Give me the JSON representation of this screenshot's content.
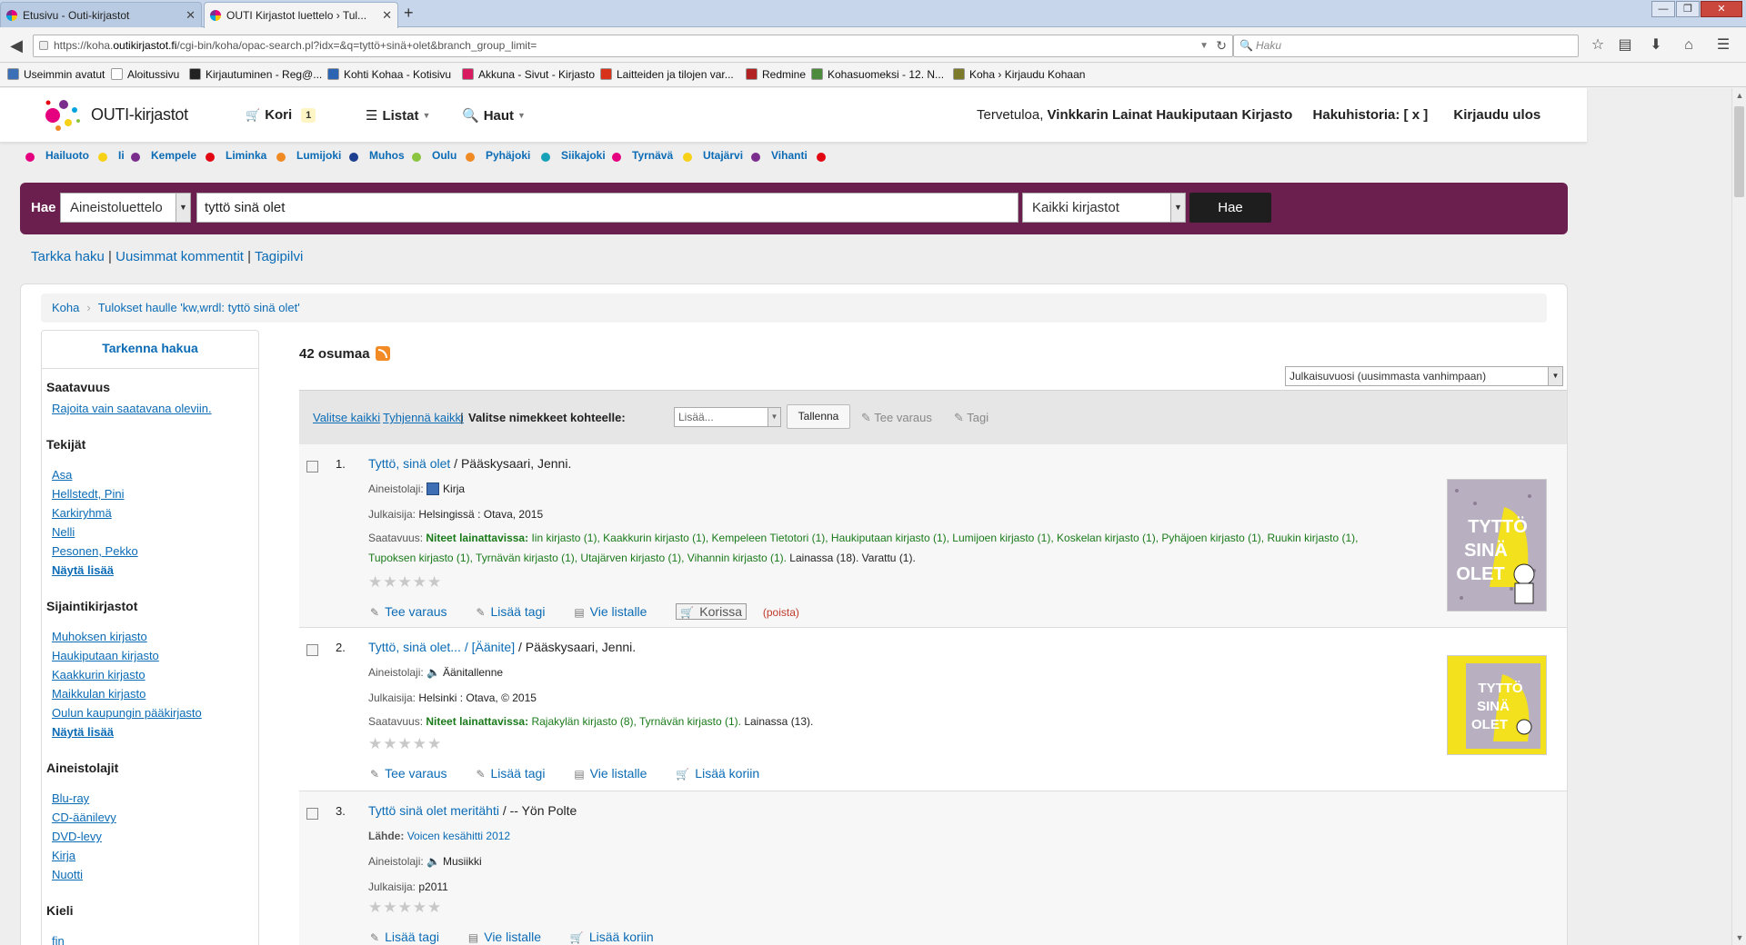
{
  "browser": {
    "tabs": [
      {
        "label": "Etusivu - Outi-kirjastot"
      },
      {
        "label": "OUTI Kirjastot luettelo › Tul..."
      }
    ],
    "new_tab": "+",
    "url_prefix": "https://koha.",
    "url_host": "outikirjastot.fi",
    "url_rest": "/cgi-bin/koha/opac-search.pl?idx=&q=tyttö+sinä+olet&branch_group_limit=",
    "search_placeholder": "Haku",
    "bookmarks": [
      {
        "label": "Useimmin avatut",
        "color": "#3b6fb6"
      },
      {
        "label": "Aloitussivu",
        "color": "#ffffff"
      },
      {
        "label": "Kirjautuminen - Reg@...",
        "color": "#222222"
      },
      {
        "label": "Kohti Kohaa - Kotisivu",
        "color": "#2b64b2"
      },
      {
        "label": "Akkuna - Sivut - Kirjasto",
        "color": "#d81b60"
      },
      {
        "label": "Laitteiden ja tilojen var...",
        "color": "#d8321b"
      },
      {
        "label": "Redmine",
        "color": "#b22222"
      },
      {
        "label": "Kohasuomeksi - 12. N...",
        "color": "#4c8a3c"
      },
      {
        "label": "Koha › Kirjaudu Kohaan",
        "color": "#7a7a2a"
      }
    ]
  },
  "site": {
    "logo_text": "OUTI-kirjastot",
    "nav": {
      "cart_label": "Kori",
      "cart_count": "1",
      "lists_label": "Listat",
      "searches_label": "Haut"
    },
    "welcome_prefix": "Tervetuloa, ",
    "welcome_name": "Vinkkarin Lainat Haukiputaan Kirjasto",
    "history_label": "Hakuhistoria: [ x ]",
    "logout_label": "Kirjaudu ulos"
  },
  "branches": [
    {
      "name": "Hailuoto",
      "color": "#e4007f"
    },
    {
      "name": "Ii",
      "color": "#f7d117"
    },
    {
      "name": "Kempele",
      "color": "#7b2d8e"
    },
    {
      "name": "Liminka",
      "color": "#e30613"
    },
    {
      "name": "Lumijoki",
      "color": "#f08a24"
    },
    {
      "name": "Muhos",
      "color": "#1d3f8f"
    },
    {
      "name": "Oulu",
      "color": "#8bc53f"
    },
    {
      "name": "Pyhäjoki",
      "color": "#f08a24"
    },
    {
      "name": "Siikajoki",
      "color": "#17a2b8"
    },
    {
      "name": "Tyrnävä",
      "color": "#e4007f"
    },
    {
      "name": "Utajärvi",
      "color": "#f7d117"
    },
    {
      "name": "Vihanti",
      "color": "#7b2d8e"
    }
  ],
  "branch_trailing_dot": "#e30613",
  "search": {
    "label": "Hae",
    "scope": "Aineistoluettelo",
    "query": "tyttö sinä olet",
    "library": "Kaikki kirjastot",
    "button": "Hae"
  },
  "sublinks": [
    "Tarkka haku",
    "Uusimmat kommentit",
    "Tagipilvi"
  ],
  "breadcrumb": [
    "Koha",
    "Tulokset haulle 'kw,wrdl: tyttö sinä olet'"
  ],
  "facets": {
    "title": "Tarkenna hakua",
    "groups": [
      {
        "title": "Saatavuus",
        "items": [
          "Rajoita vain saatavana oleviin."
        ]
      },
      {
        "title": "Tekijät",
        "items": [
          "Asa",
          "Hellstedt, Pini",
          "Karkiryhmä",
          "Nelli",
          "Pesonen, Pekko"
        ],
        "more": "Näytä lisää"
      },
      {
        "title": "Sijaintikirjastot",
        "items": [
          "Muhoksen kirjasto",
          "Haukiputaan kirjasto",
          "Kaakkurin kirjasto",
          "Maikkulan kirjasto",
          "Oulun kaupungin pääkirjasto"
        ],
        "more": "Näytä lisää"
      },
      {
        "title": "Aineistolajit",
        "items": [
          "Blu-ray",
          "CD-äänilevy",
          "DVD-levy",
          "Kirja",
          "Nuotti"
        ]
      },
      {
        "title": "Kieli",
        "items": [
          "fin"
        ]
      }
    ]
  },
  "results": {
    "count_label": "42 osumaa",
    "sort": "Julkaisuvuosi (uusimmasta vanhimpaan)",
    "toolbar": {
      "select_all": "Valitse kaikki",
      "clear_all": "Tyhjennä kaikki",
      "sep": "|",
      "target_label": "Valitse nimekkeet kohteelle:",
      "target_select": "Lisää...",
      "save": "Tallenna",
      "reserve": "Tee varaus",
      "tag": "Tagi"
    },
    "records": [
      {
        "num": "1.",
        "title": "Tyttö, sinä olet",
        "author": " / Pääskysaari, Jenni.",
        "type_label": "Aineistolaji:",
        "type": "Kirja",
        "pub_label": "Julkaisija:",
        "pub": "Helsingissä : Otava, 2015",
        "avail_label": "Saatavuus:",
        "avail_head": "Niteet lainattavissa:",
        "avail_libs": "Iin kirjasto (1), Kaakkurin kirjasto (1), Kempeleen Tietotori (1), Haukiputaan kirjasto (1), Lumijoen kirjasto (1), Koskelan kirjasto (1), Pyhäjoen kirjasto (1), Ruukin kirjasto (1), Tupoksen kirjasto (1), Tyrnävän kirjasto (1), Utajärven kirjasto (1), Vihannin kirjasto (1).",
        "avail_other": " Lainassa (18). Varattu (1).",
        "actions": [
          "Tee varaus",
          "Lisää tagi",
          "Vie listalle"
        ],
        "in_basket": "Korissa",
        "remove": "(poista)",
        "cover_text": "TYTTÖ SINÄ OLET"
      },
      {
        "num": "2.",
        "title": "Tyttö, sinä olet... / [Äänite]",
        "author": " / Pääskysaari, Jenni.",
        "type_label": "Aineistolaji:",
        "type": "Äänitallenne",
        "pub_label": "Julkaisija:",
        "pub": "Helsinki : Otava, © 2015",
        "avail_label": "Saatavuus:",
        "avail_head": "Niteet lainattavissa:",
        "avail_libs": "Rajakylän kirjasto (8), Tyrnävän kirjasto (1).",
        "avail_other": " Lainassa (13).",
        "actions": [
          "Tee varaus",
          "Lisää tagi",
          "Vie listalle",
          "Lisää koriin"
        ],
        "cover_text": "TYTTÖ SINÄ OLET"
      },
      {
        "num": "3.",
        "title": "Tyttö sinä olet meritähti",
        "author": " / -- Yön Polte",
        "source_label": "Lähde:",
        "source": "Voicen kesähitti 2012",
        "type_label": "Aineistolaji:",
        "type": "Musiikki",
        "pub_label": "Julkaisija:",
        "pub": "p2011",
        "actions": [
          "Lisää tagi",
          "Vie listalle",
          "Lisää koriin"
        ]
      }
    ],
    "stars": "★★★★★"
  }
}
